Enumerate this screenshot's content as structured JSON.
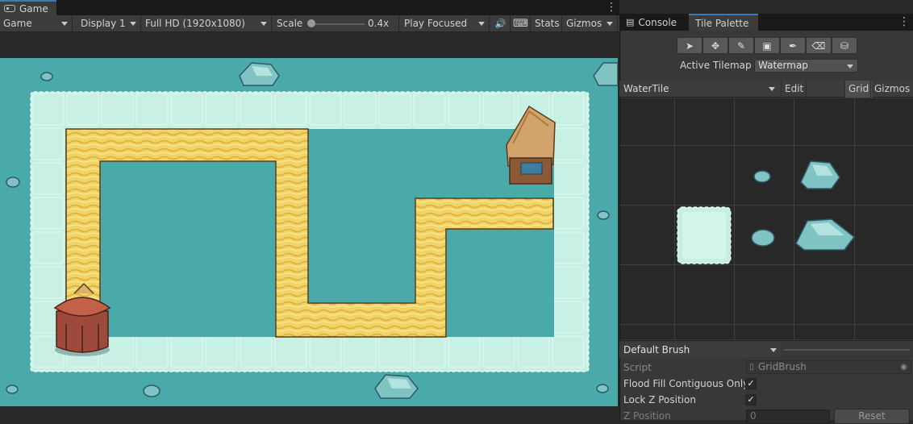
{
  "game_window": {
    "tab_label": "Game",
    "toolbar": {
      "mode": "Game",
      "display": "Display 1",
      "resolution": "Full HD (1920x1080)",
      "scale_label": "Scale",
      "scale_value": "0.4x",
      "play_mode": "Play Focused",
      "stats_label": "Stats",
      "gizmos_label": "Gizmos"
    }
  },
  "scene": {
    "colors": {
      "water": "#4aa9a9",
      "water_tile": "#c6efe4",
      "path": "#f0d160",
      "hut_roof": "#d4a86a",
      "tower": "#9b4a3a"
    }
  },
  "tile_palette_window": {
    "tabs": [
      {
        "label": "Console"
      },
      {
        "label": "Tile Palette"
      }
    ],
    "tools": [
      {
        "icon": "select-arrow-icon"
      },
      {
        "icon": "move-icon"
      },
      {
        "icon": "paint-brush-icon"
      },
      {
        "icon": "box-fill-icon"
      },
      {
        "icon": "picker-icon"
      },
      {
        "icon": "eraser-icon"
      },
      {
        "icon": "fill-bucket-icon"
      }
    ],
    "active_tilemap_label": "Active Tilemap",
    "active_tilemap_value": "Watermap",
    "palette": {
      "selected": "WaterTile",
      "edit_label": "Edit",
      "grid_label": "Grid",
      "gizmos_label": "Gizmos"
    },
    "brush": {
      "selected": "Default Brush",
      "script_label": "Script",
      "script_value": "GridBrush",
      "flood_fill_label": "Flood Fill Contiguous Only",
      "flood_fill_checked": true,
      "lock_z_label": "Lock Z Position",
      "lock_z_checked": true,
      "z_position_label": "Z Position",
      "z_position_value": "0",
      "reset_label": "Reset"
    }
  }
}
